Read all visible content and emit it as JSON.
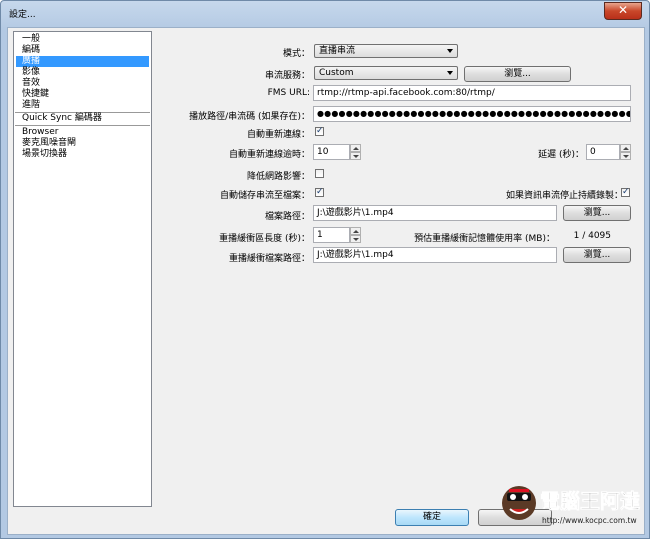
{
  "window": {
    "title": "設定...",
    "close_symbol": "✕"
  },
  "sidebar": {
    "items": [
      "一般",
      "編碼",
      "廣播",
      "影像",
      "音效",
      "快捷鍵",
      "進階",
      "Quick Sync 編碼器",
      "Browser",
      "麥克風噪音閘",
      "場景切換器"
    ],
    "selected": "廣播"
  },
  "form": {
    "mode": {
      "label": "模式：",
      "value": "直播串流"
    },
    "service": {
      "label": "串流服務：",
      "value": "Custom",
      "browse": "瀏覽..."
    },
    "fms_url": {
      "label": "FMS URL:",
      "value": "rtmp://rtmp-api.facebook.com:80/rtmp/"
    },
    "stream_key": {
      "label": "播放路徑/串流碼 (如果存在)：",
      "value": "●●●●●●●●●●●●●●●●●●●●●●●●●●●●●●●●●●●●●●●●●●●●●●●●●●●●●●●●●●●●"
    },
    "auto_reconnect": {
      "label": "自動重新連線：",
      "checked": true
    },
    "reconnect_timeout": {
      "label": "自動重新連線逾時：",
      "value": "10"
    },
    "delay": {
      "label": "延遲 (秒)：",
      "value": "0"
    },
    "reduce_latency": {
      "label": "降低網路影響：",
      "checked": false
    },
    "auto_save": {
      "label": "自動儲存串流至檔案：",
      "checked": true
    },
    "keep_recording": {
      "label": "如果資訊串流停止持續錄製：",
      "checked": true
    },
    "file_path": {
      "label": "檔案路徑：",
      "value": "J:\\遊戲影片\\1.mp4",
      "browse": "瀏覽..."
    },
    "replay_buffer": {
      "label": "重播緩衝區長度 (秒)：",
      "value": "1"
    },
    "estimated_memory": {
      "label": "預估重播緩衝記憶體使用率 (MB)：",
      "value": "1 / 4095"
    },
    "replay_path": {
      "label": "重播緩衝檔案路徑：",
      "value": "J:\\遊戲影片\\1.mp4",
      "browse": "瀏覽..."
    }
  },
  "footer": {
    "ok": "確定"
  },
  "watermark": {
    "brand": "電腦王阿達",
    "url": "http://www.kocpc.com.tw"
  }
}
